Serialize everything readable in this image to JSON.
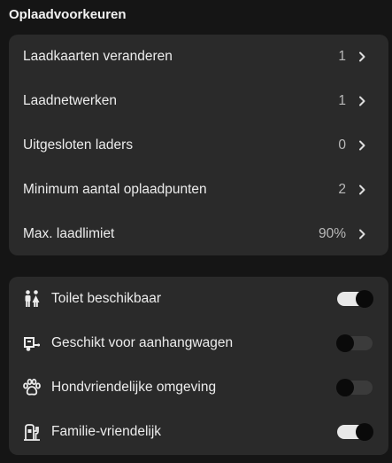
{
  "section_title": "Oplaadvoorkeuren",
  "preferences": [
    {
      "label": "Laadkaarten veranderen",
      "value": "1"
    },
    {
      "label": "Laadnetwerken",
      "value": "1"
    },
    {
      "label": "Uitgesloten laders",
      "value": "0"
    },
    {
      "label": "Minimum aantal oplaadpunten",
      "value": "2"
    },
    {
      "label": "Max. laadlimiet",
      "value": "90%"
    }
  ],
  "filters": [
    {
      "label": "Toilet beschikbaar",
      "icon": "restroom-icon",
      "enabled": true
    },
    {
      "label": "Geschikt voor aanhangwagen",
      "icon": "trailer-icon",
      "enabled": false
    },
    {
      "label": "Hondvriendelijke omgeving",
      "icon": "paw-icon",
      "enabled": false
    },
    {
      "label": "Familie-vriendelijk",
      "icon": "family-icon",
      "enabled": true
    }
  ],
  "colors": {
    "background": "#151515",
    "card": "#2a2a2a",
    "toggle_on": "#e8e8e8",
    "toggle_off": "#3b3b3b"
  }
}
